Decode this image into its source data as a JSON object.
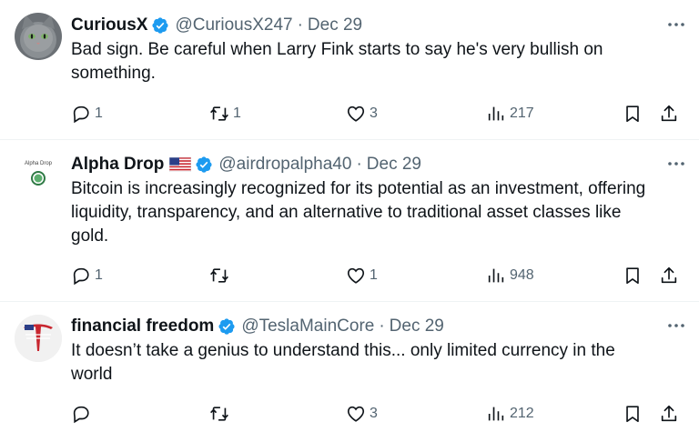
{
  "tweets": [
    {
      "name": "CuriousX",
      "handle": "@CuriousX247",
      "separator": "·",
      "date": "Dec 29",
      "text_lines": [
        "Bad sign. Be careful when Larry Fink starts to say he's very bullish on",
        "something."
      ],
      "replies": "1",
      "retweets": "1",
      "likes": "3",
      "views": "217",
      "avatar_icon": "cat-avatar"
    },
    {
      "name": "Alpha Drop",
      "handle": "@airdropalpha40",
      "separator": "·",
      "date": "Dec 29",
      "avatar_text": "Alpha Drop",
      "text_lines": [
        "Bitcoin is increasingly recognized for its potential as an investment, offering",
        "liquidity, transparency, and an alternative to traditional asset classes like",
        "gold."
      ],
      "replies": "1",
      "retweets": "",
      "likes": "1",
      "views": "948",
      "flag_icon": "us-flag-icon"
    },
    {
      "name": "financial freedom",
      "handle": "@TeslaMainCore",
      "separator": "·",
      "date": "Dec 29",
      "text_lines": [
        "It doesn’t take a genius to understand this... only limited currency in the",
        "world"
      ],
      "replies": "",
      "retweets": "",
      "likes": "3",
      "views": "212",
      "avatar_icon": "tesla-flag-logo"
    }
  ],
  "colors": {
    "text": "#0f1419",
    "secondary": "#536471",
    "verified": "#1d9bf0",
    "divider": "#eff3f4"
  }
}
